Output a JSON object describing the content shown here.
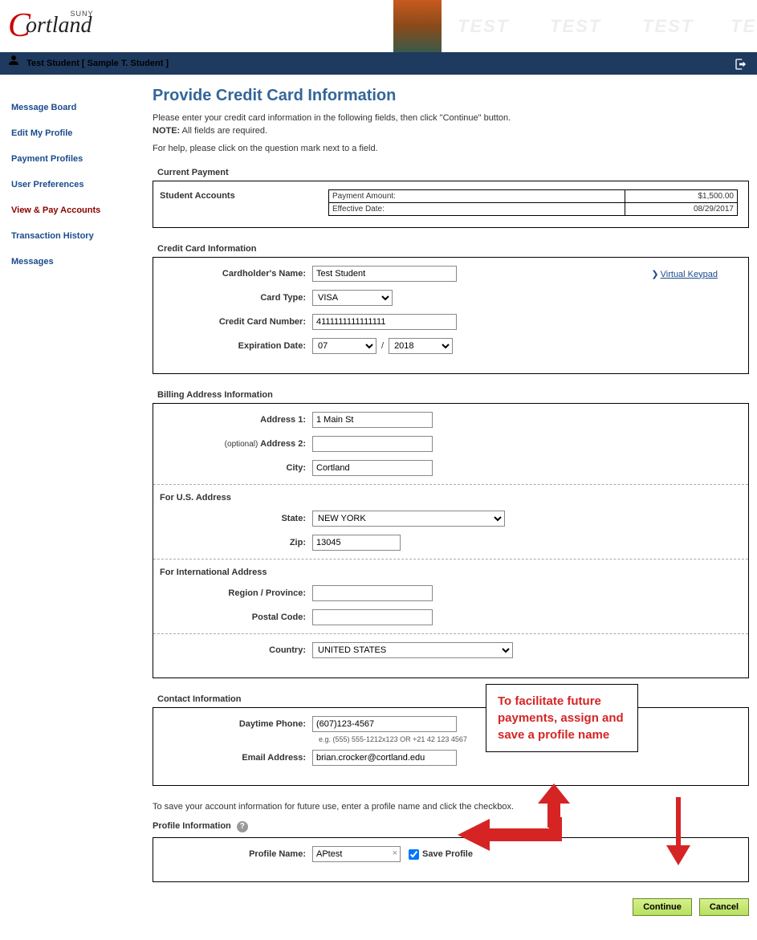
{
  "logo": {
    "suny": "SUNY",
    "rest": "ortland"
  },
  "watermarks": [
    "TEST",
    "TEST",
    "TEST",
    "TE"
  ],
  "user": {
    "name": "Test Student [ Sample T. Student ]"
  },
  "sidebar": {
    "items": [
      {
        "label": "Message Board"
      },
      {
        "label": "Edit My Profile"
      },
      {
        "label": "Payment Profiles"
      },
      {
        "label": "User Preferences"
      },
      {
        "label": "View & Pay Accounts"
      },
      {
        "label": "Transaction History"
      },
      {
        "label": "Messages"
      }
    ]
  },
  "page": {
    "title": "Provide Credit Card Information",
    "intro": "Please enter your credit card information in the following fields, then click \"Continue\" button.",
    "note_label": "NOTE:",
    "note_text": " All fields are required.",
    "help_line": "For help, please click on the question mark next to a field."
  },
  "current_payment": {
    "section_label": "Current Payment",
    "account_label": "Student Accounts",
    "rows": [
      {
        "label": "Payment Amount:",
        "value": "$1,500.00"
      },
      {
        "label": "Effective Date:",
        "value": "08/29/2017"
      }
    ]
  },
  "cc": {
    "section_label": "Credit Card Information",
    "cardholder_label": "Cardholder's Name:",
    "cardholder_value": "Test Student",
    "cardtype_label": "Card Type:",
    "cardtype_value": "VISA",
    "ccnum_label": "Credit Card Number:",
    "ccnum_value": "4111111111111111",
    "exp_label": "Expiration Date:",
    "exp_month": "07",
    "exp_sep": "/",
    "exp_year": "2018",
    "vk_label": "Virtual Keypad"
  },
  "billing": {
    "section_label": "Billing Address Information",
    "addr1_label": "Address 1:",
    "addr1_value": "1 Main St",
    "addr2_opt": "(optional) ",
    "addr2_label": "Address 2:",
    "addr2_value": "",
    "city_label": "City:",
    "city_value": "Cortland",
    "us_label": "For U.S. Address",
    "state_label": "State:",
    "state_value": "NEW YORK",
    "zip_label": "Zip:",
    "zip_value": "13045",
    "intl_label": "For International Address",
    "region_label": "Region / Province:",
    "region_value": "",
    "postal_label": "Postal Code:",
    "postal_value": "",
    "country_label": "Country:",
    "country_value": "UNITED STATES"
  },
  "contact": {
    "section_label": "Contact Information",
    "phone_label": "Daytime Phone:",
    "phone_value": "(607)123-4567",
    "phone_hint": "e.g. (555) 555-1212x123  OR  +21 42 123 4567",
    "email_label": "Email Address:",
    "email_value": "brian.crocker@cortland.edu"
  },
  "profile": {
    "save_note": "To save your account information for future use, enter a profile name and click the checkbox.",
    "section_label": "Profile Information",
    "name_label": "Profile Name:",
    "name_value": "APtest",
    "save_chk_label": "Save Profile"
  },
  "buttons": {
    "continue": "Continue",
    "cancel": "Cancel"
  },
  "callout": {
    "text": "To facilitate future payments, assign and save a profile name"
  }
}
